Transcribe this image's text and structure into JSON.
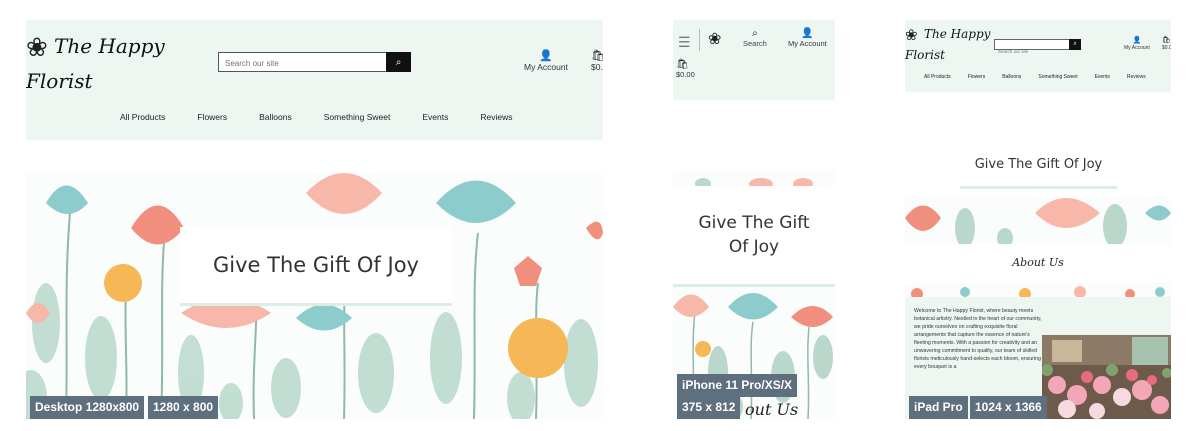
{
  "brand": {
    "name_line1": "The Happy",
    "name_line2": "Florist",
    "logo_glyph": "❀"
  },
  "header": {
    "search_placeholder": "Search our site",
    "search_button_glyph": "⌕",
    "account_label": "My Account",
    "account_glyph": "👤",
    "bag_amount": "$0.00",
    "bag_glyph": "🛍",
    "mobile_search_label": "Search",
    "menu_glyph": "☰"
  },
  "nav": {
    "items": [
      "All Products",
      "Flowers",
      "Balloons",
      "Something Sweet",
      "Events",
      "Reviews"
    ]
  },
  "hero": {
    "title": "Give The Gift Of Joy"
  },
  "about": {
    "title": "About Us",
    "peek": "out Us",
    "text": "Welcome to The Happy Florist, where beauty meets botanical artistry. Nestled in the heart of our community, we pride ourselves on crafting exquisite floral arrangements that capture the essence of nature's fleeting moments. With a passion for creativity and an unwavering commitment to quality, our team of skilled florists meticulously hand-selects each bloom, ensuring every bouquet is a"
  },
  "devices": {
    "desktop": {
      "name": "Desktop 1280x800",
      "size": "1280 x 800"
    },
    "iphone": {
      "name": "iPhone 11 Pro/XS/X",
      "size": "375 x 812"
    },
    "ipad": {
      "name": "iPad Pro",
      "size": "1024 x 1366"
    }
  },
  "colors": {
    "header_bg": "#eef6f2",
    "badge_bg": "#5e6f7e"
  }
}
